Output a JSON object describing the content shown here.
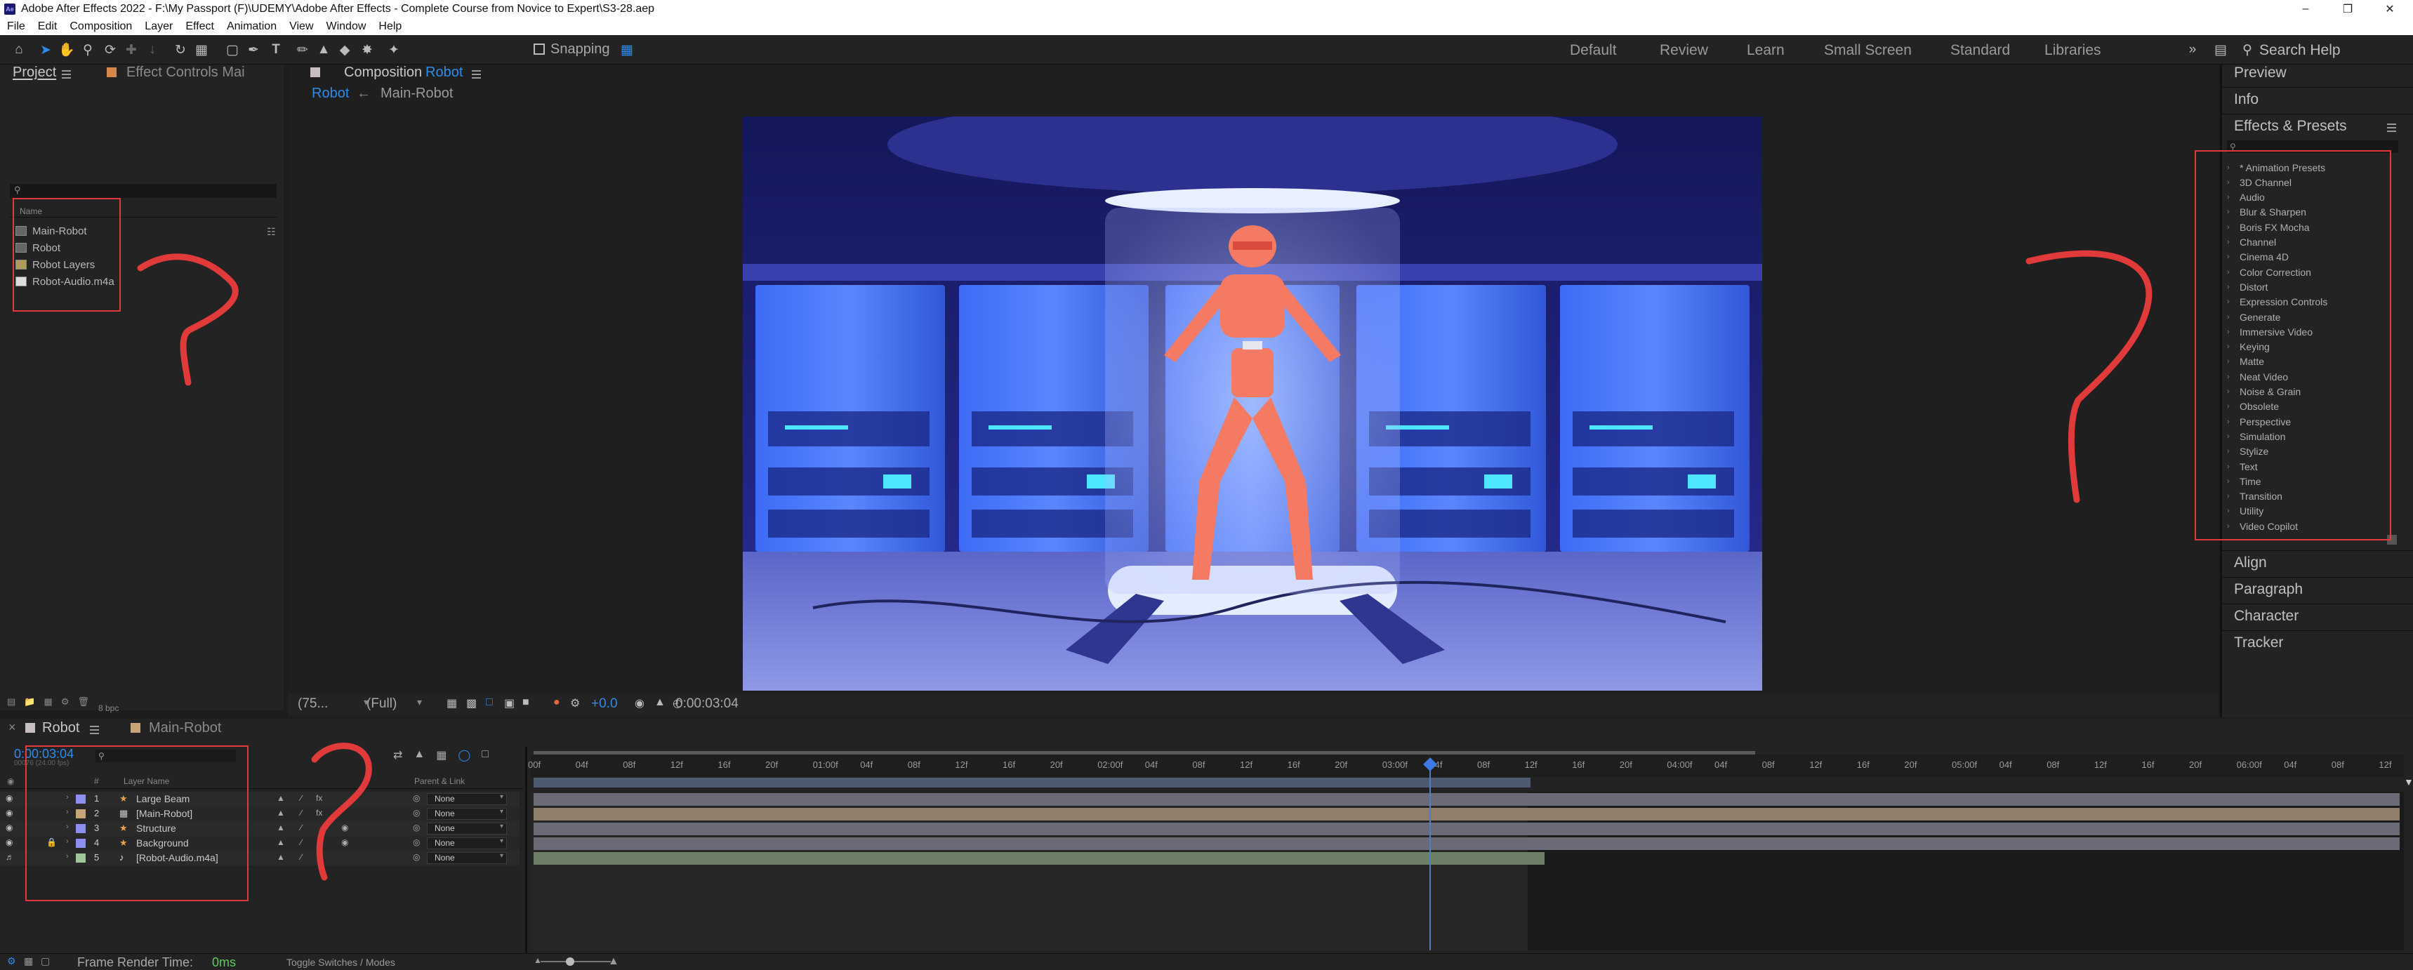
{
  "app": {
    "title": "Adobe After Effects 2022 - F:\\My Passport (F)\\UDEMY\\Adobe After Effects - Complete Course from Novice to Expert\\S3-28.aep",
    "icon_text": "Ae"
  },
  "menu": [
    "File",
    "Edit",
    "Composition",
    "Layer",
    "Effect",
    "Animation",
    "View",
    "Window",
    "Help"
  ],
  "toolbar": {
    "snapping_label": "Snapping",
    "workspaces": [
      "Default",
      "Review",
      "Learn",
      "Small Screen",
      "Standard",
      "Libraries"
    ],
    "search_label": "Search Help"
  },
  "project_panel": {
    "tab_project": "Project",
    "tab_effect_controls": "Effect Controls Mai",
    "name_header": "Name",
    "items": [
      {
        "name": "Main-Robot",
        "icon": "composition-icon"
      },
      {
        "name": "Robot",
        "icon": "composition-icon"
      },
      {
        "name": "Robot Layers",
        "icon": "folder-icon"
      },
      {
        "name": "Robot-Audio.m4a",
        "icon": "audio-file-icon"
      }
    ],
    "bpc": "8 bpc"
  },
  "composition": {
    "tab_label": "Composition",
    "comp_name": "Robot",
    "breadcrumbs": [
      "Robot",
      "Main-Robot"
    ],
    "zoom": "(75...",
    "resolution": "(Full)",
    "exposure": "+0.0",
    "timecode": "0:00:03:04"
  },
  "right_panels": {
    "preview": "Preview",
    "info": "Info",
    "effects_presets": "Effects & Presets",
    "categories": [
      "* Animation Presets",
      "3D Channel",
      "Audio",
      "Blur & Sharpen",
      "Boris FX Mocha",
      "Channel",
      "Cinema 4D",
      "Color Correction",
      "Distort",
      "Expression Controls",
      "Generate",
      "Immersive Video",
      "Keying",
      "Matte",
      "Neat Video",
      "Noise & Grain",
      "Obsolete",
      "Perspective",
      "Simulation",
      "Stylize",
      "Text",
      "Time",
      "Transition",
      "Utility",
      "Video Copilot"
    ],
    "align": "Align",
    "paragraph": "Paragraph",
    "character": "Character",
    "tracker": "Tracker"
  },
  "timeline": {
    "tab_robot": "Robot",
    "tab_main_robot": "Main-Robot",
    "timecode": "0:00:03:04",
    "frame_info": "00076 (24.00 fps)",
    "col_layer_name": "Layer Name",
    "col_parent": "Parent & Link",
    "layers": [
      {
        "num": "1",
        "name": "Large Beam",
        "icon": "shape-layer-icon",
        "parent": "None",
        "color": "#8e8ef0"
      },
      {
        "num": "2",
        "name": "[Main-Robot]",
        "icon": "composition-icon",
        "parent": "None",
        "color": "#c9a479"
      },
      {
        "num": "3",
        "name": "Structure",
        "icon": "shape-layer-icon",
        "parent": "None",
        "color": "#8e8ef0"
      },
      {
        "num": "4",
        "name": "Background",
        "icon": "shape-layer-icon",
        "parent": "None",
        "color": "#8e8ef0"
      },
      {
        "num": "5",
        "name": "[Robot-Audio.m4a]",
        "icon": "audio-file-icon",
        "parent": "None",
        "color": "#9fc59a"
      }
    ],
    "ruler": [
      "00f",
      "04f",
      "08f",
      "12f",
      "16f",
      "20f",
      "01:00f",
      "04f",
      "08f",
      "12f",
      "16f",
      "20f",
      "02:00f",
      "04f",
      "08f",
      "12f",
      "16f",
      "20f",
      "03:00f",
      "04f",
      "08f",
      "12f",
      "16f",
      "20f",
      "04:00f",
      "04f",
      "08f",
      "12f",
      "16f",
      "20f",
      "05:00f",
      "04f",
      "08f",
      "12f",
      "16f",
      "20f",
      "06:00f",
      "04f",
      "08f",
      "12f"
    ],
    "frame_render_label": "Frame Render Time:",
    "frame_render_value": "0ms",
    "toggle_label": "Toggle Switches / Modes"
  },
  "colors": {
    "accent": "#2d8ceb",
    "annotation": "#e03a3a",
    "panel": "#232323",
    "bg": "#1d1d1d"
  }
}
